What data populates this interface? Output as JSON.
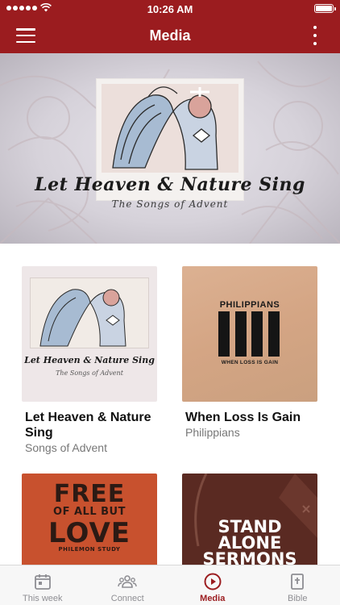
{
  "status_bar": {
    "time": "10:26 AM"
  },
  "nav": {
    "title": "Media",
    "menu_icon": "hamburger-icon",
    "more_icon": "more-vertical-icon"
  },
  "hero": {
    "title": "Let Heaven & Nature Sing",
    "subtitle": "The Songs of Advent"
  },
  "series": [
    {
      "title": "Let Heaven & Nature Sing",
      "subtitle": "Songs of Advent",
      "art": {
        "line1": "Let Heaven & Nature Sing",
        "line2": "The Songs of Advent"
      }
    },
    {
      "title": "When Loss Is Gain",
      "subtitle": "Philippians",
      "art": {
        "header": "PHILIPPIANS",
        "footer": "WHEN LOSS IS GAIN"
      }
    },
    {
      "title": "",
      "subtitle": "",
      "art": {
        "line1": "FREE",
        "line2": "OF ALL BUT",
        "line3": "LOVE",
        "line4": "PHILEMON STUDY"
      }
    },
    {
      "title": "",
      "subtitle": "",
      "art": {
        "line1": "STAND",
        "line2": "ALONE",
        "line3": "SERMONS"
      }
    }
  ],
  "tabs": [
    {
      "label": "This week",
      "icon": "calendar-icon",
      "active": false
    },
    {
      "label": "Connect",
      "icon": "people-icon",
      "active": false
    },
    {
      "label": "Media",
      "icon": "play-circle-icon",
      "active": true
    },
    {
      "label": "Bible",
      "icon": "bible-icon",
      "active": false
    }
  ],
  "colors": {
    "brand": "#9b1c1f",
    "tab_inactive": "#8e8e93"
  }
}
